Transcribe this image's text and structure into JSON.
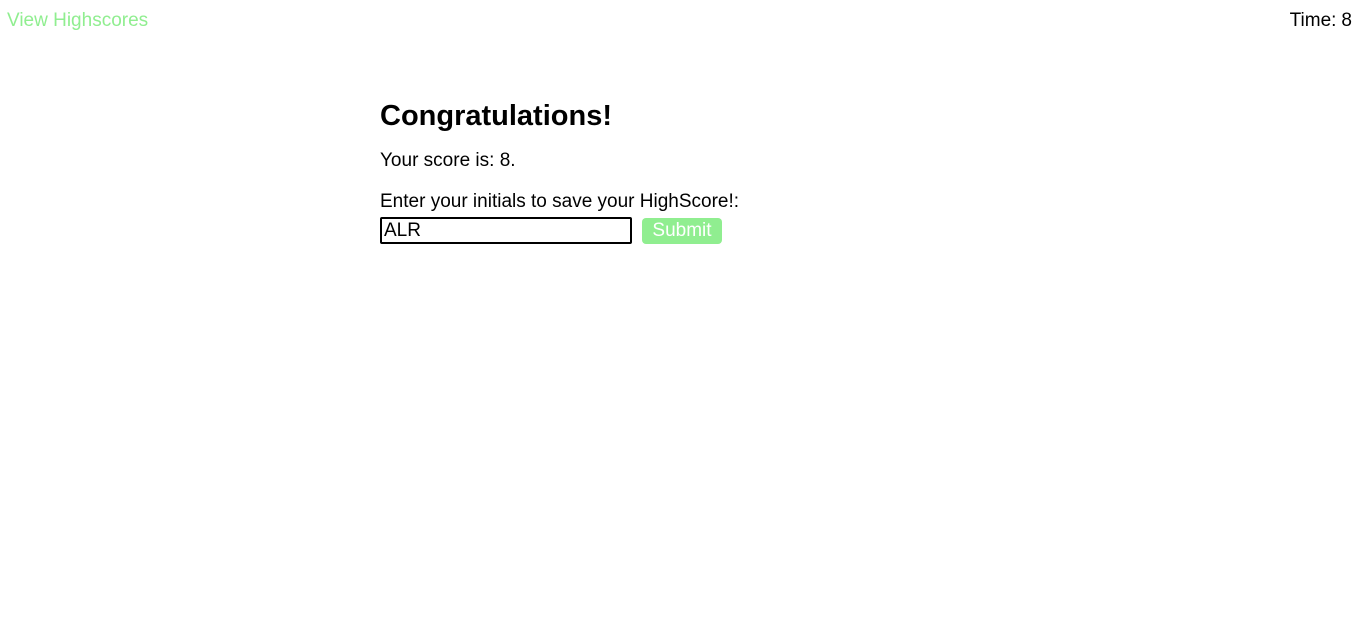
{
  "header": {
    "highscores_link": "View Highscores",
    "timer_label": "Time:",
    "timer_value": "8"
  },
  "main": {
    "title": "Congratulations!",
    "score_label": "Your score is:",
    "score_value": "8",
    "score_suffix": ".",
    "prompt": "Enter your initials to save your HighScore!:",
    "initials_value": "ALR",
    "submit_label": "Submit"
  },
  "colors": {
    "accent": "#90ee90",
    "text": "#000000",
    "background": "#ffffff"
  }
}
